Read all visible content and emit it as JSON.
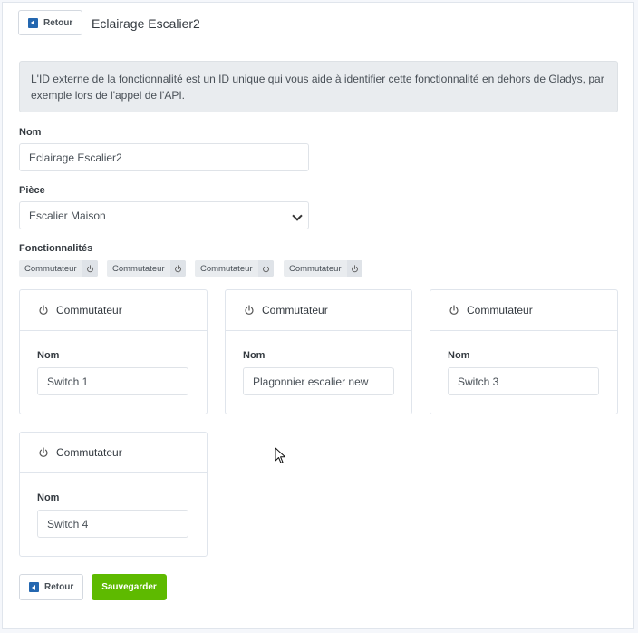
{
  "header": {
    "back_label": "Retour",
    "title": "Eclairage Escalier2"
  },
  "alert": {
    "text": "L'ID externe de la fonctionnalité est un ID unique qui vous aide à identifier cette fonctionnalité en dehors de Gladys, par exemple lors de l'appel de l'API."
  },
  "form": {
    "name_label": "Nom",
    "name_value": "Eclairage Escalier2",
    "room_label": "Pièce",
    "room_value": "Escalier Maison",
    "features_label": "Fonctionnalités"
  },
  "tags": [
    "Commutateur",
    "Commutateur",
    "Commutateur",
    "Commutateur"
  ],
  "features": [
    {
      "title": "Commutateur",
      "name_label": "Nom",
      "name_value": "Switch 1"
    },
    {
      "title": "Commutateur",
      "name_label": "Nom",
      "name_value": "Plagonnier escalier new"
    },
    {
      "title": "Commutateur",
      "name_label": "Nom",
      "name_value": "Switch 3"
    },
    {
      "title": "Commutateur",
      "name_label": "Nom",
      "name_value": "Switch 4"
    }
  ],
  "footer": {
    "back_label": "Retour",
    "save_label": "Sauvegarder"
  },
  "colors": {
    "save_button": "#5eba00",
    "back_icon": "#2467b0",
    "alert_bg": "#e9ecef"
  },
  "icons": {
    "back": "arrow-left-icon",
    "power": "power-icon",
    "select": "chevron-down-icon",
    "cursor": "mouse-cursor-icon"
  }
}
